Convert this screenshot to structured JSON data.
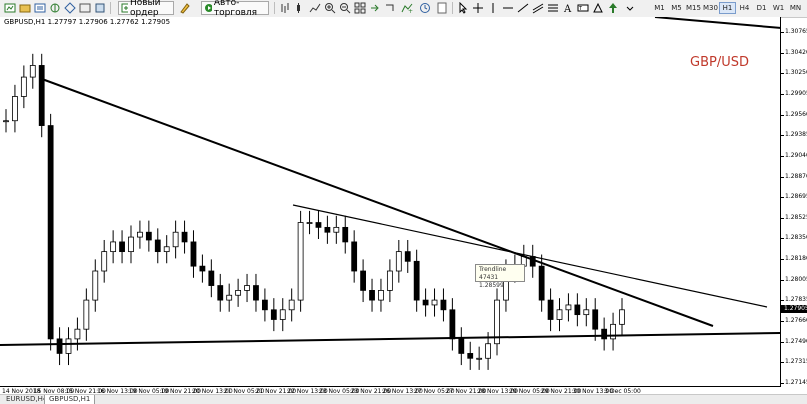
{
  "toolbar": {
    "new_order_label": "Новый ордер",
    "autotrading_label": "Авто-торговля",
    "timeframes": [
      "M1",
      "M5",
      "M15",
      "M30",
      "H1",
      "H4",
      "D1",
      "W1",
      "MN"
    ]
  },
  "chart": {
    "title": "GBPUSD,H1 1.27797 1.27906 1.27762 1.27905",
    "pair_label": "GBP/USD",
    "current_price": "1.27905",
    "price_labels": [
      "1.30765",
      "1.30420",
      "1.30250",
      "1.29905",
      "1.29560",
      "1.29385",
      "1.29040",
      "1.28870",
      "1.28695",
      "1.28525",
      "1.28350",
      "1.28180",
      "1.28005",
      "1.27835",
      "1.27660",
      "1.27490",
      "1.27315",
      "1.27145"
    ],
    "time_labels": [
      "14 Nov 2018",
      "15 Nov 08:00",
      "15 Nov 21:00",
      "16 Nov 13:00",
      "19 Nov 05:00",
      "19 Nov 21:00",
      "20 Nov 13:00",
      "21 Nov 05:00",
      "21 Nov 21:00",
      "22 Nov 13:00",
      "23 Nov 05:00",
      "23 Nov 21:00",
      "26 Nov 13:00",
      "27 Nov 05:00",
      "27 Nov 21:00",
      "28 Nov 13:00",
      "29 Nov 05:00",
      "29 Nov 21:00",
      "30 Nov 13:00",
      "3 Dec 05:00"
    ],
    "tooltip_title": "Trendline 47431",
    "tooltip_value": "1.28599",
    "colors": {
      "candle": "#000000",
      "trendline": "#000000",
      "label": "#c0392b",
      "background": "#ffffff"
    }
  },
  "tabs": [
    "EURUSD,H4",
    "GBPUSD,H1"
  ],
  "active_tab": "GBPUSD,H1",
  "chart_data": {
    "type": "candlestick",
    "title": "GBPUSD,H1",
    "ylim": [
      1.27145,
      1.30765
    ],
    "series": [
      {
        "name": "GBPUSD,H1",
        "values": [
          1.2985,
          1.301,
          1.303,
          1.3042,
          1.298,
          1.276,
          1.2745,
          1.276,
          1.277,
          1.28,
          1.283,
          1.285,
          1.286,
          1.285,
          1.2865,
          1.287,
          1.2862,
          1.285,
          1.2855,
          1.287,
          1.286,
          1.2835,
          1.283,
          1.2815,
          1.28,
          1.2805,
          1.281,
          1.2815,
          1.28,
          1.279,
          1.278,
          1.279,
          1.28,
          1.288,
          1.288,
          1.2875,
          1.287,
          1.2875,
          1.286,
          1.283,
          1.281,
          1.28,
          1.281,
          1.283,
          1.285,
          1.284,
          1.28,
          1.2795,
          1.28,
          1.279,
          1.276,
          1.2745,
          1.274,
          1.274,
          1.2755,
          1.28,
          1.283,
          1.2835,
          1.2845,
          1.2835,
          1.28,
          1.278,
          1.279,
          1.2795,
          1.2785,
          1.279,
          1.277,
          1.276,
          1.2775,
          1.279
        ]
      }
    ]
  }
}
